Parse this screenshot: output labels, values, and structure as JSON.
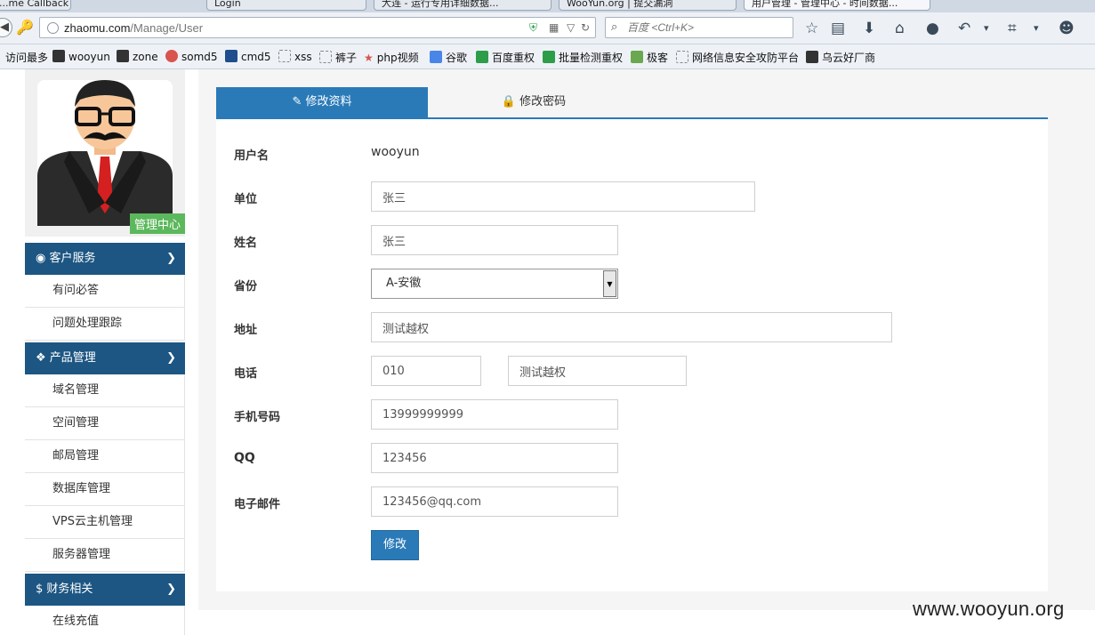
{
  "browser": {
    "tabs": [
      "...me Callback",
      "Login",
      "大连 - 运行专用详细数据...",
      "WooYun.org | 提交漏洞",
      "用户管理 - 管理中心 - 时间数据..."
    ],
    "url_host": "zhaomu.com",
    "url_path": "/Manage/User",
    "search_placeholder": "百度 <Ctrl+K>",
    "bookmarks": [
      {
        "label": "访问最多",
        "color": ""
      },
      {
        "label": "wooyun",
        "color": "#333333"
      },
      {
        "label": "zone",
        "color": "#333333"
      },
      {
        "label": "somd5",
        "color": "#d9534f"
      },
      {
        "label": "cmd5",
        "color": "#1f4e8c"
      },
      {
        "label": "xss",
        "color": ""
      },
      {
        "label": "裤子",
        "color": ""
      },
      {
        "label": "php视频",
        "color": "#d9534f"
      },
      {
        "label": "谷歌",
        "color": "#4a86e8"
      },
      {
        "label": "百度重权",
        "color": "#2d9d4a"
      },
      {
        "label": "批量检测重权",
        "color": "#2d9d4a"
      },
      {
        "label": "极客",
        "color": "#6aa84f"
      },
      {
        "label": "网络信息安全攻防平台",
        "color": ""
      },
      {
        "label": "乌云好厂商",
        "color": "#333333"
      }
    ]
  },
  "sidebar": {
    "badge": "管理中心",
    "sections": [
      {
        "title": "客户服务",
        "icon": "dashboard-icon",
        "glyph": "◉",
        "items": [
          "有问必答",
          "问题处理跟踪"
        ]
      },
      {
        "title": "产品管理",
        "icon": "cubes-icon",
        "glyph": "❖",
        "items": [
          "域名管理",
          "空间管理",
          "邮局管理",
          "数据库管理",
          "VPS云主机管理",
          "服务器管理"
        ]
      },
      {
        "title": "财务相关",
        "icon": "dollar-icon",
        "glyph": "$",
        "items": [
          "在线充值"
        ]
      }
    ]
  },
  "panel": {
    "tab_edit": "修改资料",
    "tab_password": "修改密码",
    "form": {
      "username_label": "用户名",
      "username_value": "wooyun",
      "company_label": "单位",
      "company_value": "张三",
      "name_label": "姓名",
      "name_value": "张三",
      "province_label": "省份",
      "province_value": "A-安徽",
      "address_label": "地址",
      "address_value": "测试越权",
      "phone_label": "电话",
      "phone_area": "010",
      "phone_number": "测试越权",
      "mobile_label": "手机号码",
      "mobile_value": "13999999999",
      "qq_label": "QQ",
      "qq_value": "123456",
      "email_label": "电子邮件",
      "email_value": "123456@qq.com",
      "submit_label": "修改"
    }
  },
  "watermark": "www.wooyun.org"
}
